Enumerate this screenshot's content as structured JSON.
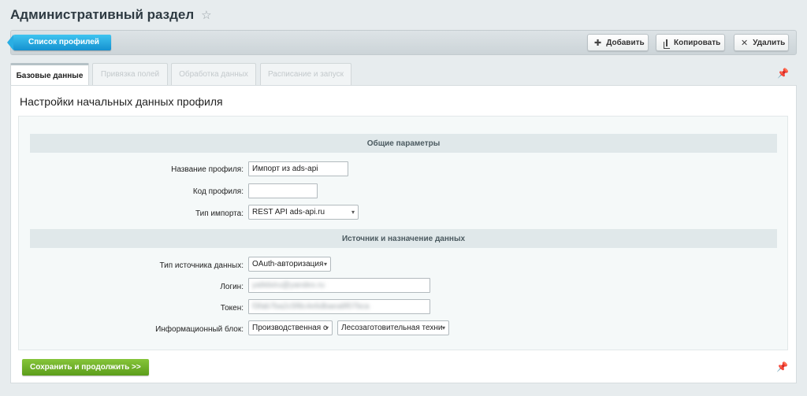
{
  "header": {
    "title": "Административный раздел"
  },
  "toolbar": {
    "profiles_list_label": "Список профилей",
    "add_label": "Добавить",
    "copy_label": "Копировать",
    "delete_label": "Удалить"
  },
  "tabs": [
    {
      "label": "Базовые данные",
      "active": true
    },
    {
      "label": "Привязка полей",
      "active": false
    },
    {
      "label": "Обработка данных",
      "active": false
    },
    {
      "label": "Расписание и запуск",
      "active": false
    }
  ],
  "section": {
    "title": "Настройки начальных данных профиля"
  },
  "general": {
    "header": "Общие параметры",
    "profile_name_label": "Название профиля:",
    "profile_name_value": "Импорт из ads-api",
    "profile_code_label": "Код профиля:",
    "profile_code_value": "",
    "import_type_label": "Тип импорта:",
    "import_type_value": "REST API ads-api.ru"
  },
  "source": {
    "header": "Источник и назначение данных",
    "source_type_label": "Тип источника данных:",
    "source_type_value": "OAuth-авторизация",
    "login_label": "Логин:",
    "login_value": "ya9dxiru@yandex.ru",
    "token_label": "Токен:",
    "token_value": "f3fab7ba2c5f8c4e6dbaea8f07bca",
    "iblock_label": "Информационный блок:",
    "iblock_type_value": "Производственная с",
    "iblock_value": "Лесозаготовительная техни"
  },
  "footer": {
    "save_label": "Сохранить и продолжить >>"
  }
}
